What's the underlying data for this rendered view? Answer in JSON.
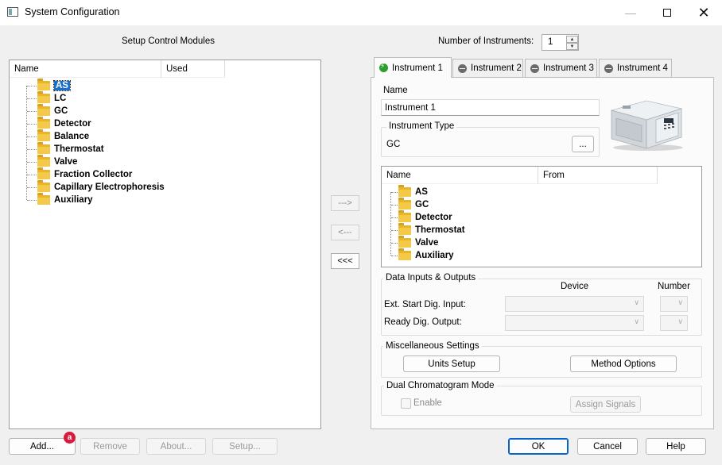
{
  "window": {
    "title": "System Configuration"
  },
  "left": {
    "section_title": "Setup Control Modules",
    "columns": [
      "Name",
      "Used"
    ],
    "tree_items": [
      "AS",
      "LC",
      "GC",
      "Detector",
      "Balance",
      "Thermostat",
      "Valve",
      "Fraction Collector",
      "Capillary Electrophoresis",
      "Auxiliary"
    ],
    "selected_item": "AS"
  },
  "middle": {
    "add_label": "--->",
    "remove_label": "<---",
    "remove_all_label": "<<<"
  },
  "instruments": {
    "count_label": "Number of Instruments:",
    "count_value": "1",
    "tabs": [
      "Instrument 1",
      "Instrument 2",
      "Instrument 3",
      "Instrument 4"
    ],
    "active_tab": "Instrument 1"
  },
  "panel": {
    "name_label": "Name",
    "name_value": "Instrument 1",
    "type_group": "Instrument Type",
    "type_value": "GC",
    "type_browse": "...",
    "modules_columns": [
      "Name",
      "From"
    ],
    "modules": [
      "AS",
      "GC",
      "Detector",
      "Thermostat",
      "Valve",
      "Auxiliary"
    ],
    "io_group": "Data Inputs & Outputs",
    "io_device_header": "Device",
    "io_number_header": "Number",
    "io_rows": [
      "Ext. Start Dig. Input:",
      "Ready Dig. Output:"
    ],
    "misc_group": "Miscellaneous Settings",
    "units_setup": "Units Setup",
    "method_options": "Method Options",
    "dual_group": "Dual Chromatogram Mode",
    "enable_label": "Enable",
    "assign_signals": "Assign Signals"
  },
  "footer": {
    "add": "Add...",
    "badge": "a",
    "remove": "Remove",
    "about": "About...",
    "setup": "Setup...",
    "ok": "OK",
    "cancel": "Cancel",
    "help": "Help"
  },
  "colors": {
    "accent": "#0a64c8",
    "selection": "#1a6fc9",
    "folder": "#e8b42a",
    "badge": "#d81b3c"
  }
}
